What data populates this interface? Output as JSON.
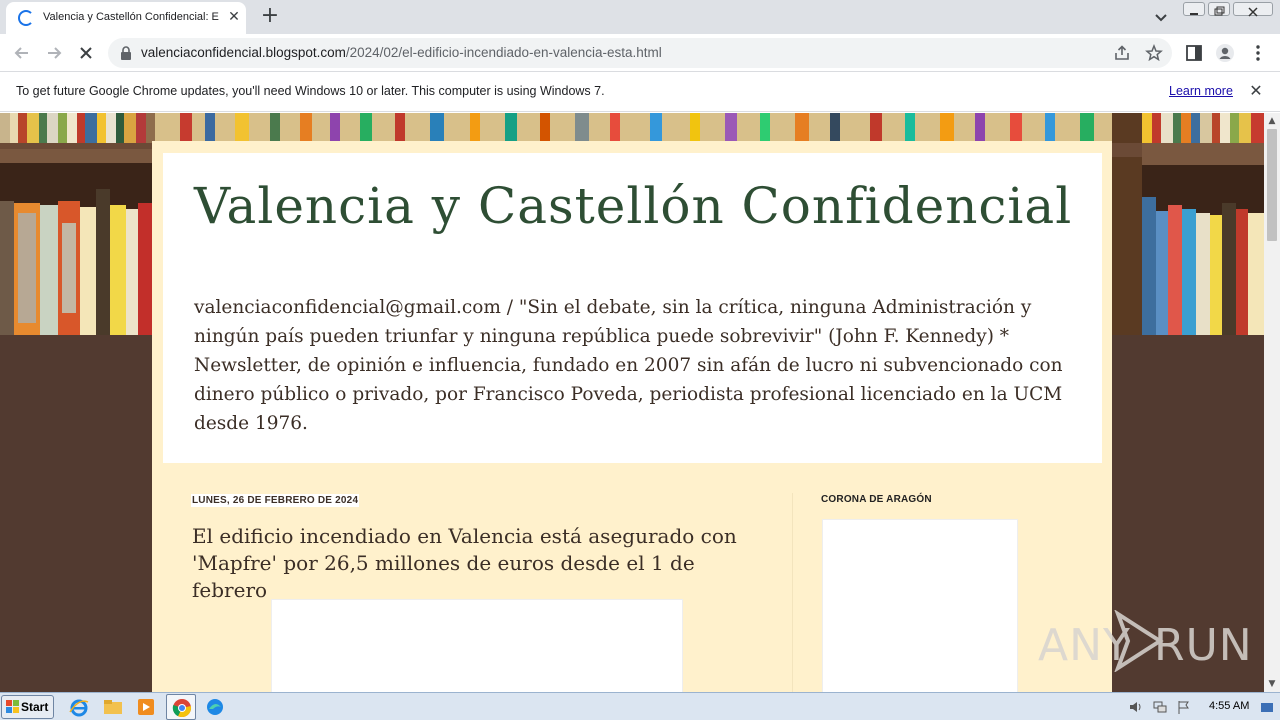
{
  "browser": {
    "tab_title": "Valencia y Castellón Confidencial: El",
    "tab_close": "✕",
    "new_tab": "+",
    "url_domain": "valenciaconfidencial.blogspot.com",
    "url_path": "/2024/02/el-edificio-incendiado-en-valencia-esta.html",
    "icons": [
      "tab-spinner-icon",
      "back-icon",
      "forward-icon",
      "stop-icon",
      "lock-icon",
      "share-icon",
      "star-icon",
      "side-panel-icon",
      "profile-icon",
      "menu-icon"
    ]
  },
  "infobar": {
    "message": "To get future Google Chrome updates, you'll need Windows 10 or later. This computer is using Windows 7.",
    "learn_more": "Learn more",
    "close": "✕"
  },
  "blog": {
    "title": "Valencia y Castellón Confidencial",
    "description": "valenciaconfidencial@gmail.com / \"Sin el debate, sin la crítica, ninguna Administración y ningún país pueden triunfar y ninguna república puede sobrevivir\" (John F. Kennedy) * Newsletter, de opinión e influencia, fundado en 2007 sin afán de lucro ni subvencionado con dinero público o privado, por Francisco Poveda, periodista profesional licenciado en la UCM desde 1976."
  },
  "post": {
    "date": "LUNES, 26 DE FEBRERO DE 2024",
    "title": "El edificio incendiado en Valencia está asegurado con 'Mapfre' por 26,5 millones de euros desde el 1 de febrero"
  },
  "sidebar": {
    "widget_title": "CORONA DE ARAGÓN"
  },
  "watermark": {
    "left": "ANY",
    "right": "RUN"
  },
  "taskbar": {
    "start": "Start",
    "clock": "4:55 AM"
  },
  "colors": {
    "title_green": "#2e4e34",
    "page_brown": "#523a30",
    "content_cream": "#fff1cc",
    "link_blue": "#1a0dab"
  }
}
